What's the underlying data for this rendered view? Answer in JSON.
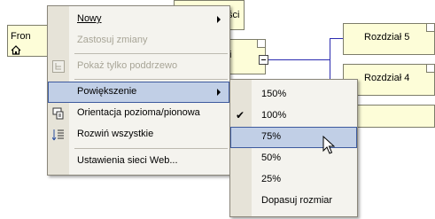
{
  "diagram": {
    "nodes": {
      "front": "Fron",
      "top_partial": "ści",
      "mid_partial": "i",
      "chapter5": "Rozdział 5",
      "chapter4": "Rozdział 4"
    }
  },
  "context_menu": {
    "items": [
      {
        "label": "Nowy",
        "mnemonic": "N",
        "submenu": true,
        "enabled": true
      },
      {
        "label": "Zastosuj zmiany",
        "enabled": false
      },
      {
        "label": "Pokaż tylko poddrzewo",
        "enabled": false,
        "icon": "subtree-icon"
      },
      {
        "label": "Powiększenie",
        "submenu": true,
        "enabled": true,
        "highlighted": true
      },
      {
        "label": "Orientacja pozioma/pionowa",
        "enabled": true,
        "icon": "orientation-icon"
      },
      {
        "label": "Rozwiń wszystkie",
        "enabled": true,
        "icon": "expand-all-icon"
      },
      {
        "label": "Ustawienia sieci Web...",
        "enabled": true
      }
    ]
  },
  "zoom_submenu": {
    "items": [
      {
        "label": "150%",
        "checked": false
      },
      {
        "label": "100%",
        "checked": true
      },
      {
        "label": "75%",
        "checked": false,
        "highlighted": true
      },
      {
        "label": "50%",
        "checked": false
      },
      {
        "label": "25%",
        "checked": false
      },
      {
        "label": "Dopasuj rozmiar",
        "checked": false
      }
    ]
  }
}
